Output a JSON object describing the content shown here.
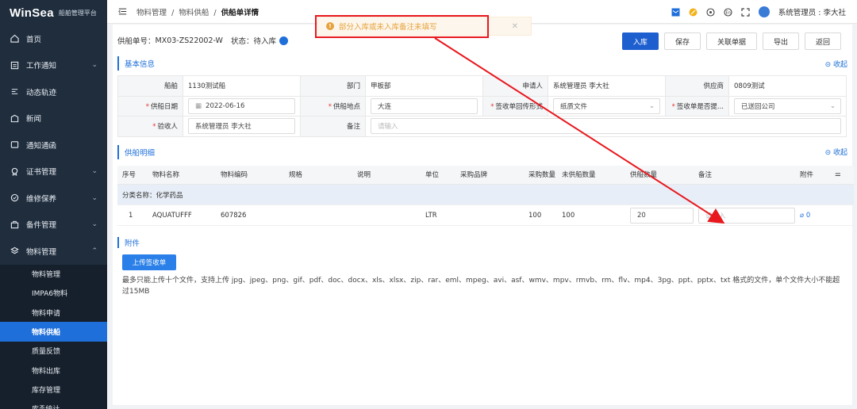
{
  "app": {
    "brand": "WinSea",
    "subtitle": "船舶管理平台"
  },
  "sidebar": {
    "items": [
      {
        "label": "首页",
        "icon": "home-icon",
        "expand": false
      },
      {
        "label": "工作通知",
        "icon": "notice-icon",
        "expand": true
      },
      {
        "label": "动态轨迹",
        "icon": "track-icon",
        "expand": false
      },
      {
        "label": "新闻",
        "icon": "news-icon",
        "expand": false
      },
      {
        "label": "通知通函",
        "icon": "circular-icon",
        "expand": false
      },
      {
        "label": "证书管理",
        "icon": "certificate-icon",
        "expand": true
      },
      {
        "label": "维修保养",
        "icon": "maintenance-icon",
        "expand": true
      },
      {
        "label": "备件管理",
        "icon": "spare-parts-icon",
        "expand": true
      },
      {
        "label": "物料管理",
        "icon": "material-icon",
        "expand": true
      }
    ],
    "sub_items": [
      {
        "label": "物料管理",
        "active": false
      },
      {
        "label": "IMPA6物料",
        "active": false
      },
      {
        "label": "物料申请",
        "active": false
      },
      {
        "label": "物料供船",
        "active": true
      },
      {
        "label": "质量反馈",
        "active": false
      },
      {
        "label": "物料出库",
        "active": false
      },
      {
        "label": "库存管理",
        "active": false
      },
      {
        "label": "库존统计",
        "active": false
      }
    ]
  },
  "topbar": {
    "breadcrumb": [
      "物料管理",
      "物料供船",
      "供船单详情"
    ],
    "user": "系统管理员 : 李大社"
  },
  "toast": {
    "message": "部分入库或未入库备注未填写"
  },
  "header": {
    "order_label": "供船单号：",
    "order_no": "MX03-ZS22002-W",
    "status_label": "状态：",
    "status": "待入库"
  },
  "buttons": {
    "stock_in": "入库",
    "save": "保存",
    "related": "关联单据",
    "export": "导出",
    "back": "返回"
  },
  "basic": {
    "title": "基本信息",
    "collapse": "收起",
    "ship_label": "船舶",
    "ship": "1130测试船",
    "dept_label": "部门",
    "dept": "甲板部",
    "applicant_label": "申请人",
    "applicant": "系统管理员 李大社",
    "supplier_label": "供应商",
    "supplier": "0809测试",
    "date_label": "供船日期",
    "date": "2022-06-16",
    "place_label": "供船地点",
    "place": "大连",
    "sign_form_label": "签收单回传形式",
    "sign_form": "纸质文件",
    "sign_return_label": "签收单是否提...",
    "sign_return": "已送回公司",
    "receiver_label": "验收人",
    "receiver": "系统管理员 李大社",
    "remark_label": "备注",
    "remark_placeholder": "请输入"
  },
  "detail": {
    "title": "供船明细",
    "collapse": "收起",
    "columns": [
      "序号",
      "物料名称",
      "物料编码",
      "规格",
      "说明",
      "单位",
      "采购品牌",
      "采购数量",
      "未供船数量",
      "供船数量",
      "备注",
      "附件"
    ],
    "category_label": "分类名称：",
    "category": "化学药品",
    "rows": [
      {
        "no": "1",
        "name": "AQUATUFFF",
        "code": "607826",
        "spec": "",
        "desc": "",
        "unit": "LTR",
        "brand": "",
        "purchase_qty": "100",
        "unsupplied_qty": "100",
        "supply_qty": "20",
        "remark_placeholder": "请输入",
        "attachments": "0"
      }
    ]
  },
  "attachments": {
    "title": "附件",
    "upload_label": "上传签收单",
    "note": "最多只能上传十个文件，支持上传 jpg、jpeg、png、gif、pdf、doc、docx、xls、xlsx、zip、rar、eml、mpeg、avi、asf、wmv、mpv、rmvb、rm、flv、mp4、3pg、ppt、pptx、txt 格式的文件，单个文件大小不能超过15MB"
  },
  "colors": {
    "sidebar": "#1f2d3d",
    "accent": "#1e6fd9",
    "warning": "#e6a23c",
    "annotation": "#e8181e"
  }
}
